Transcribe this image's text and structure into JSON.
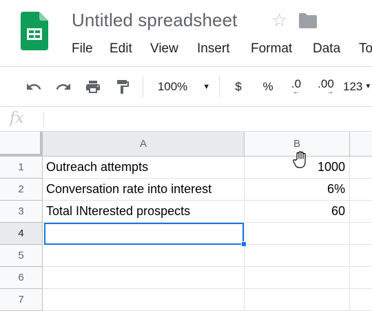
{
  "app": {
    "title": "Untitled spreadsheet",
    "logo": "google-sheets-logo",
    "accent_color": "#0f9d58",
    "selection_color": "#1a73e8"
  },
  "menu": [
    "File",
    "Edit",
    "View",
    "Insert",
    "Format",
    "Data",
    "To"
  ],
  "toolbar": {
    "icons": [
      "undo-icon",
      "redo-icon",
      "print-icon",
      "paint-format-icon"
    ],
    "zoom": "100%",
    "currency": "$",
    "percent": "%",
    "decrease_decimal": ".0",
    "increase_decimal": ".00",
    "more_formats": "123"
  },
  "formula_bar": {
    "label": "fx",
    "value": ""
  },
  "sheet": {
    "columns": [
      "A",
      "B"
    ],
    "rows": [
      {
        "row_label": "1",
        "A": "Outreach attempts",
        "B": "1000"
      },
      {
        "row_label": "2",
        "A": "Conversation rate into interest",
        "B": "6%"
      },
      {
        "row_label": "3",
        "A": "Total INterested prospects",
        "B": "60"
      },
      {
        "row_label": "4",
        "A": "",
        "B": ""
      },
      {
        "row_label": "5",
        "A": "",
        "B": ""
      },
      {
        "row_label": "6",
        "A": "",
        "B": ""
      },
      {
        "row_label": "7",
        "A": "",
        "B": ""
      }
    ],
    "selected_cell": "A4"
  }
}
